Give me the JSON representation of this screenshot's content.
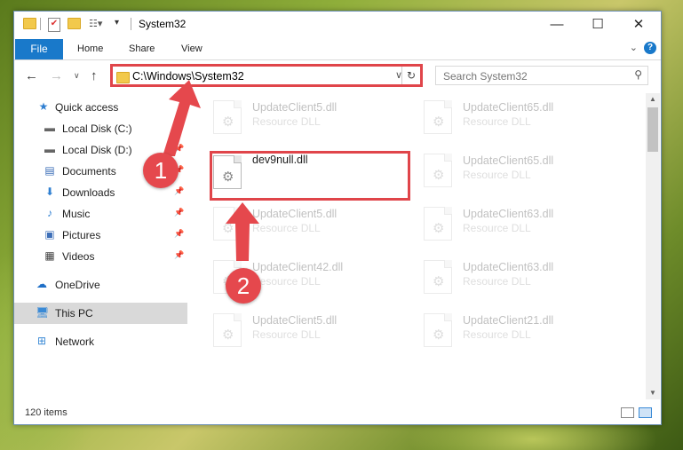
{
  "window": {
    "title": "System32",
    "controls": {
      "minimize": "—",
      "maximize": "☐",
      "close": "✕"
    }
  },
  "ribbon": {
    "tabs": [
      {
        "label": "File"
      },
      {
        "label": "Home"
      },
      {
        "label": "Share"
      },
      {
        "label": "View"
      }
    ]
  },
  "navigation": {
    "address": "C:\\Windows\\System32",
    "search_placeholder": "Search System32"
  },
  "sidebar": {
    "items": [
      {
        "label": "Quick access",
        "icon": "star-icon"
      },
      {
        "label": "Local Disk (C:)",
        "icon": "drive-icon",
        "pinned": true
      },
      {
        "label": "Local Disk (D:)",
        "icon": "drive-icon",
        "pinned": true
      },
      {
        "label": "Documents",
        "icon": "documents-icon",
        "pinned": true
      },
      {
        "label": "Downloads",
        "icon": "download-icon",
        "pinned": true
      },
      {
        "label": "Music",
        "icon": "music-icon",
        "pinned": true
      },
      {
        "label": "Pictures",
        "icon": "pictures-icon",
        "pinned": true
      },
      {
        "label": "Videos",
        "icon": "videos-icon",
        "pinned": true
      },
      {
        "label": "OneDrive",
        "icon": "cloud-icon"
      },
      {
        "label": "This PC",
        "icon": "computer-icon",
        "selected": true
      },
      {
        "label": "Network",
        "icon": "network-icon"
      }
    ]
  },
  "files": [
    {
      "name": "UpdateClient5.dll",
      "type": "Resource DLL"
    },
    {
      "name": "UpdateClient65.dll",
      "type": "Resource DLL"
    },
    {
      "name": "dev9null.dll",
      "type": "",
      "highlighted": true
    },
    {
      "name": "UpdateClient65.dll",
      "type": "Resource DLL"
    },
    {
      "name": "UpdateClient5.dll",
      "type": "Resource DLL"
    },
    {
      "name": "UpdateClient63.dll",
      "type": "Resource DLL"
    },
    {
      "name": "UpdateClient42.dll",
      "type": "Resource DLL"
    },
    {
      "name": "UpdateClient63.dll",
      "type": "Resource DLL"
    },
    {
      "name": "UpdateClient5.dll",
      "type": "Resource DLL"
    },
    {
      "name": "UpdateClient21.dll",
      "type": "Resource DLL"
    }
  ],
  "status": {
    "item_count": "120 items"
  },
  "callouts": {
    "one": "1",
    "two": "2"
  },
  "colors": {
    "accent": "#1979ca",
    "callout": "#e5484d",
    "folder": "#f2c94c"
  }
}
